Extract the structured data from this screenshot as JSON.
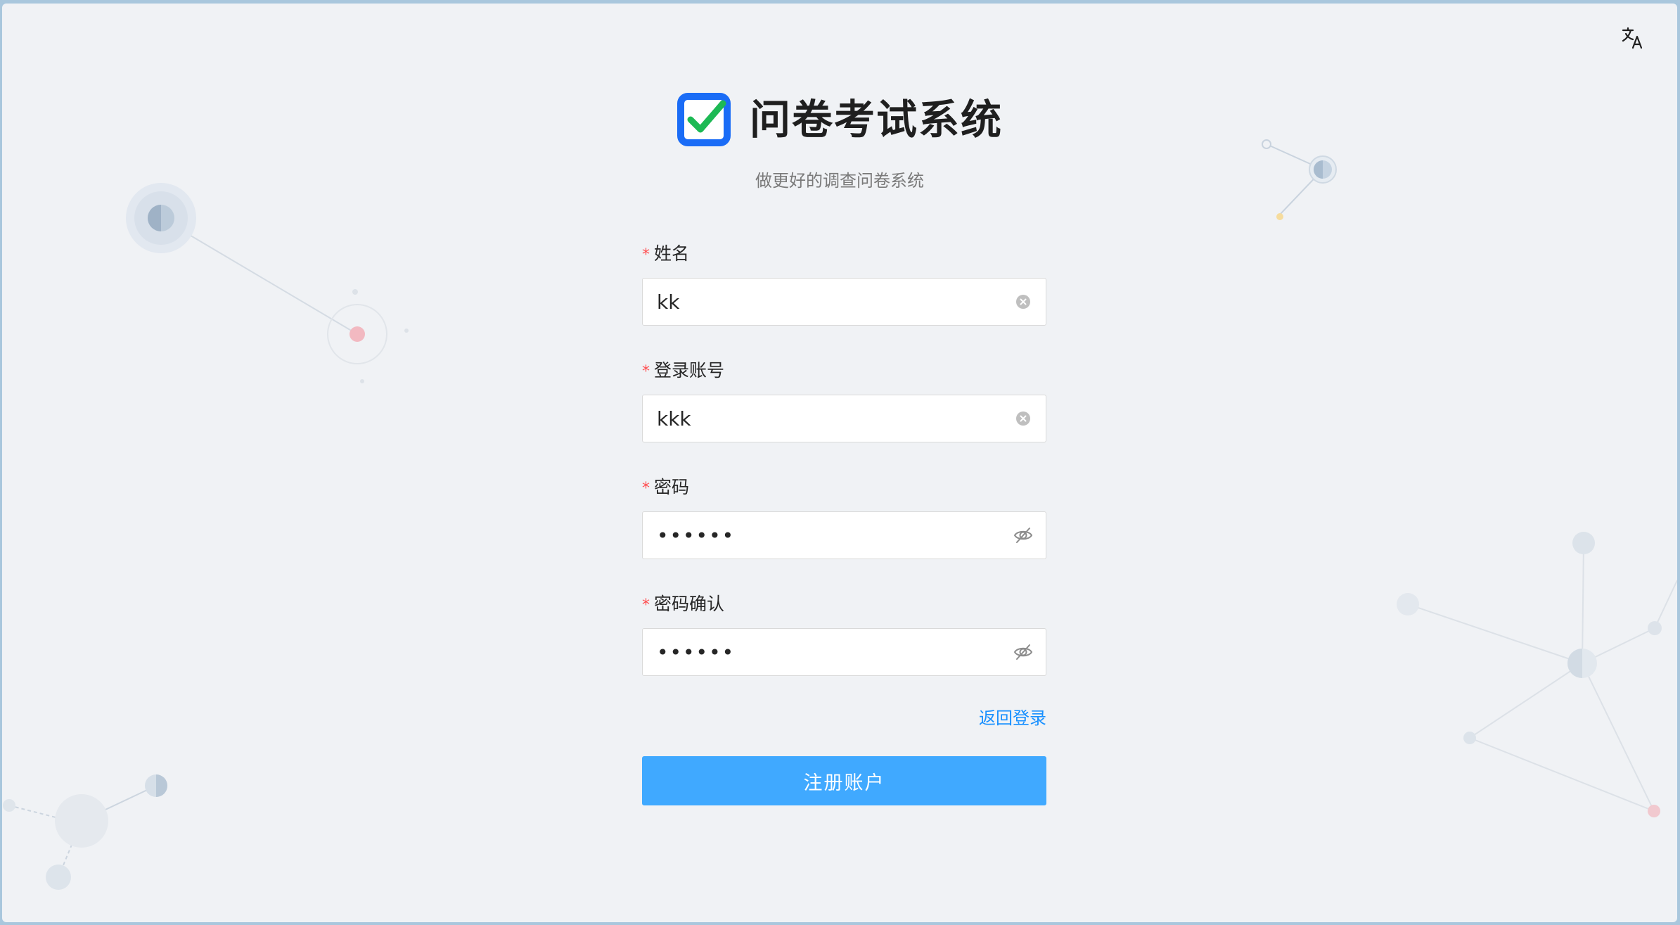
{
  "app": {
    "title": "问卷考试系统",
    "subtitle": "做更好的调查问卷系统"
  },
  "icons": {
    "language": "translate-icon",
    "logo": "checkbox-logo-icon",
    "clear": "clear-circle-icon",
    "password_toggle": "eye-invisible-icon"
  },
  "colors": {
    "primary": "#40a9ff",
    "link": "#1890ff",
    "required": "#ff4d4f",
    "logo_blue": "#1a6cf6",
    "logo_check": "#1db954",
    "background": "#f0f2f5"
  },
  "form": {
    "name": {
      "label": "姓名",
      "value": "kk"
    },
    "account": {
      "label": "登录账号",
      "value": "kkk"
    },
    "password": {
      "label": "密码",
      "value": "123456"
    },
    "confirm": {
      "label": "密码确认",
      "value": "123456"
    },
    "required_mark": "*",
    "back_link": "返回登录",
    "submit_label": "注册账户"
  }
}
